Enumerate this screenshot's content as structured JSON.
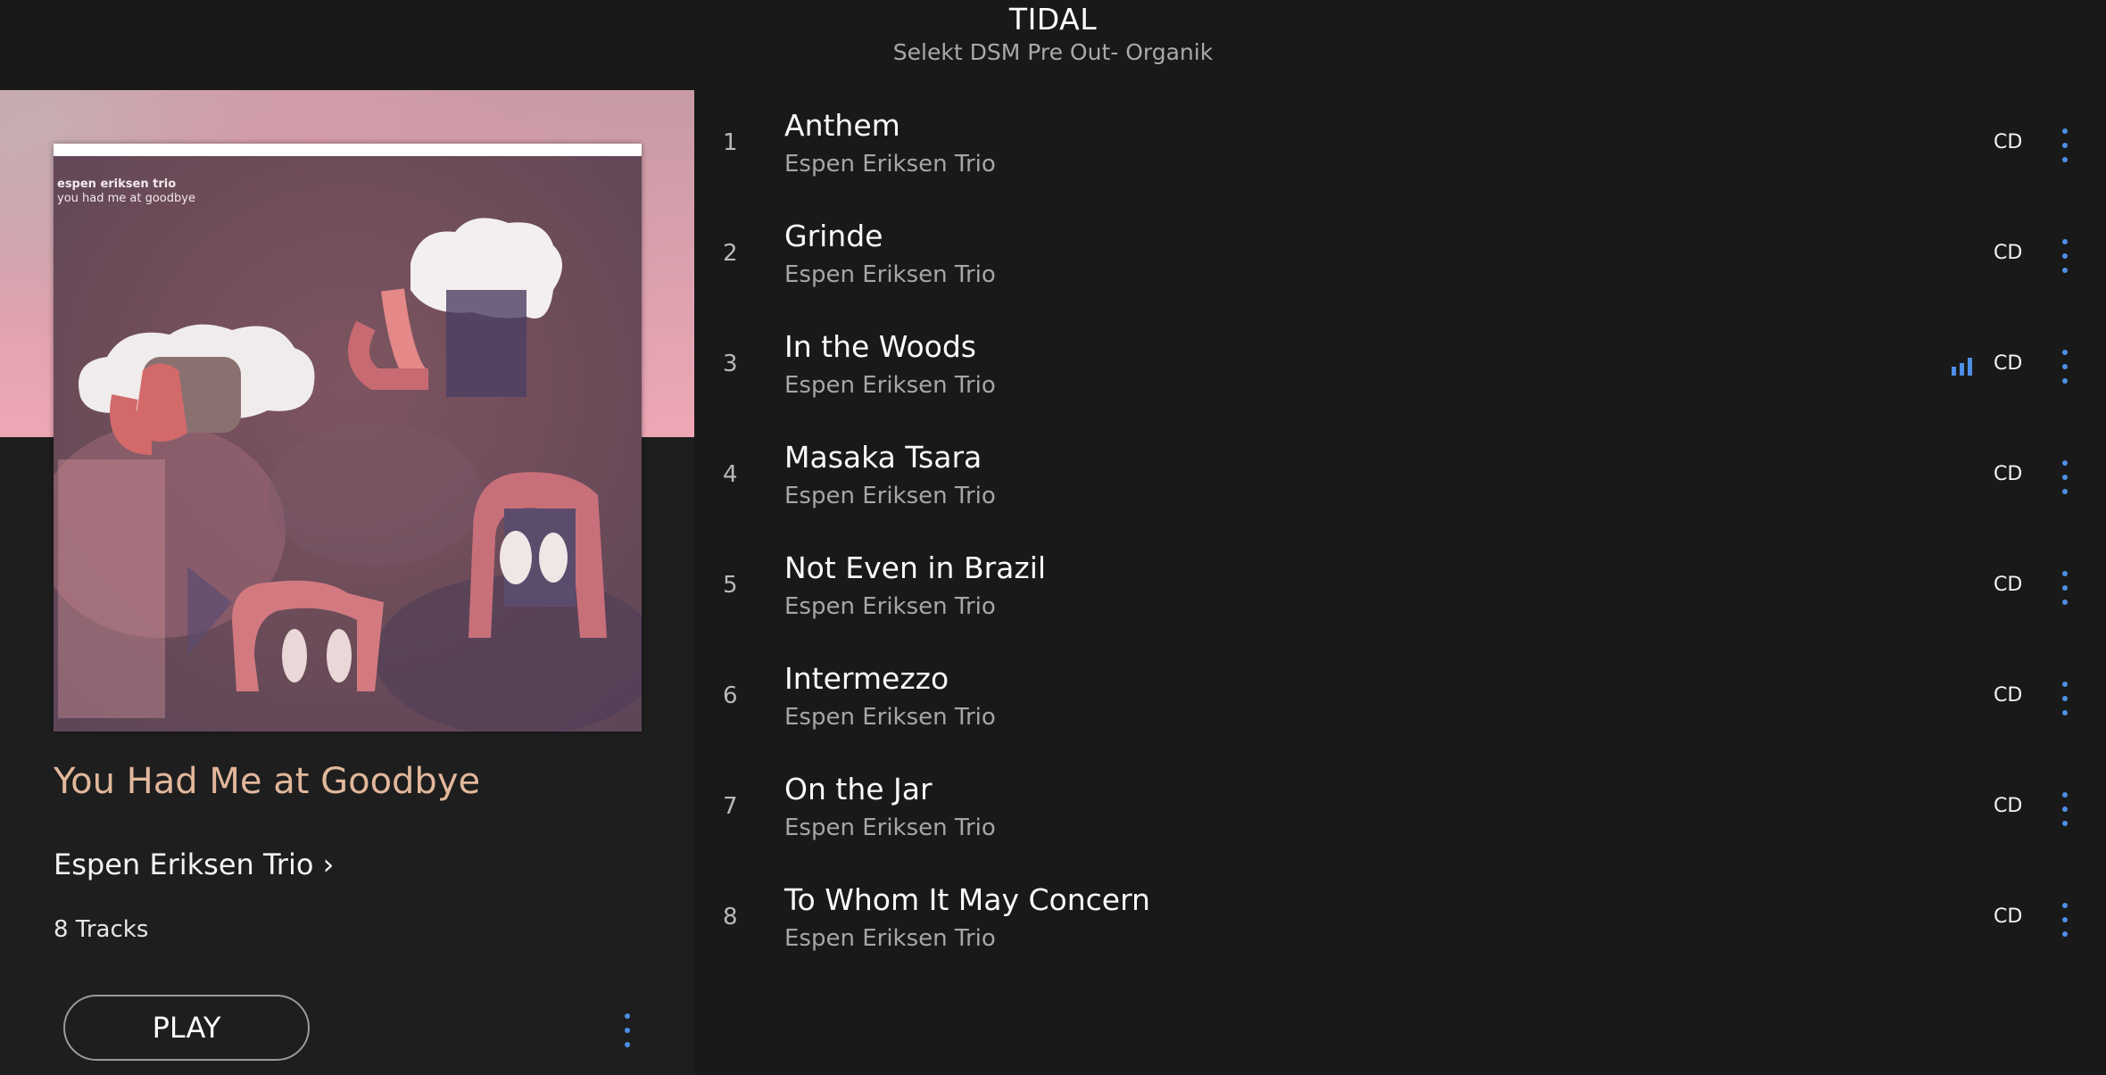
{
  "header": {
    "title": "TIDAL",
    "subtitle": "Selekt DSM Pre Out- Organik"
  },
  "album": {
    "title": "You Had Me at Goodbye",
    "artist_link": "Espen Eriksen Trio ›",
    "track_count": "8 Tracks",
    "play_label": "PLAY",
    "cover_text": {
      "artist": "espen eriksen trio",
      "album": "you had me at goodbye"
    }
  },
  "tracks": [
    {
      "number": "1",
      "title": "Anthem",
      "artist": "Espen Eriksen Trio",
      "quality": "CD",
      "playing": false
    },
    {
      "number": "2",
      "title": "Grinde",
      "artist": "Espen Eriksen Trio",
      "quality": "CD",
      "playing": false
    },
    {
      "number": "3",
      "title": "In the Woods",
      "artist": "Espen Eriksen Trio",
      "quality": "CD",
      "playing": true
    },
    {
      "number": "4",
      "title": "Masaka Tsara",
      "artist": "Espen Eriksen Trio",
      "quality": "CD",
      "playing": false
    },
    {
      "number": "5",
      "title": "Not Even in Brazil",
      "artist": "Espen Eriksen Trio",
      "quality": "CD",
      "playing": false
    },
    {
      "number": "6",
      "title": "Intermezzo",
      "artist": "Espen Eriksen Trio",
      "quality": "CD",
      "playing": false
    },
    {
      "number": "7",
      "title": "On the Jar",
      "artist": "Espen Eriksen Trio",
      "quality": "CD",
      "playing": false
    },
    {
      "number": "8",
      "title": "To Whom It May Concern",
      "artist": "Espen Eriksen Trio",
      "quality": "CD",
      "playing": false
    }
  ],
  "icons": {
    "more_options": "vertical-ellipsis-icon",
    "now_playing": "equalizer-bars-icon"
  },
  "colors": {
    "accent": "#4d8fe6",
    "album_title": "#e2b79b",
    "background": "#191919"
  }
}
